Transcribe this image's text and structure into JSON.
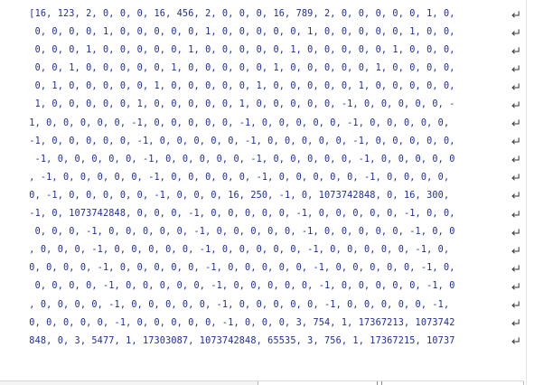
{
  "editor": {
    "lines": [
      " [16, 123, 2, 0, 0, 0, 16, 456, 2, 0, 0, 0, 16, 789, 2, 0, 0, 0, 0, 0, 1, 0,",
      "  0, 0, 0, 0, 1, 0, 0, 0, 0, 0, 1, 0, 0, 0, 0, 0, 1, 0, 0, 0, 0, 0, 1, 0, 0,",
      "  0, 0, 0, 1, 0, 0, 0, 0, 0, 1, 0, 0, 0, 0, 0, 1, 0, 0, 0, 0, 0, 1, 0, 0, 0,",
      "  0, 0, 1, 0, 0, 0, 0, 0, 1, 0, 0, 0, 0, 0, 1, 0, 0, 0, 0, 0, 1, 0, 0, 0, 0,",
      "  0, 1, 0, 0, 0, 0, 0, 1, 0, 0, 0, 0, 0, 1, 0, 0, 0, 0, 0, 1, 0, 0, 0, 0, 0,",
      "  1, 0, 0, 0, 0, 0, 1, 0, 0, 0, 0, 0, 1, 0, 0, 0, 0, 0, -1, 0, 0, 0, 0, 0, -",
      " 1, 0, 0, 0, 0, 0, -1, 0, 0, 0, 0, 0, -1, 0, 0, 0, 0, 0, -1, 0, 0, 0, 0, 0,",
      " -1, 0, 0, 0, 0, 0, -1, 0, 0, 0, 0, 0, -1, 0, 0, 0, 0, 0, -1, 0, 0, 0, 0, 0,",
      "  -1, 0, 0, 0, 0, 0, -1, 0, 0, 0, 0, 0, -1, 0, 0, 0, 0, 0, -1, 0, 0, 0, 0, 0",
      " , -1, 0, 0, 0, 0, 0, -1, 0, 0, 0, 0, 0, -1, 0, 0, 0, 0, 0, -1, 0, 0, 0, 0,",
      " 0, -1, 0, 0, 0, 0, 0, -1, 0, 0, 0, 16, 250, -1, 0, 1073742848, 0, 16, 300,",
      " -1, 0, 1073742848, 0, 0, 0, -1, 0, 0, 0, 0, 0, -1, 0, 0, 0, 0, 0, -1, 0, 0,",
      "  0, 0, 0, -1, 0, 0, 0, 0, 0, -1, 0, 0, 0, 0, 0, -1, 0, 0, 0, 0, 0, -1, 0, 0",
      " , 0, 0, 0, -1, 0, 0, 0, 0, 0, -1, 0, 0, 0, 0, 0, -1, 0, 0, 0, 0, 0, -1, 0,",
      " 0, 0, 0, 0, -1, 0, 0, 0, 0, 0, -1, 0, 0, 0, 0, 0, -1, 0, 0, 0, 0, 0, -1, 0,",
      "  0, 0, 0, 0, -1, 0, 0, 0, 0, 0, -1, 0, 0, 0, 0, 0, -1, 0, 0, 0, 0, 0, -1, 0",
      " , 0, 0, 0, 0, -1, 0, 0, 0, 0, 0, -1, 0, 0, 0, 0, 0, -1, 0, 0, 0, 0, 0, -1,",
      " 0, 0, 0, 0, 0, -1, 0, 0, 0, 0, 0, -1, 0, 0, 0, 3, 754, 1, 17367213, 1073742",
      " 848, 0, 3, 5477, 1, 17303087, 1073742848, 65535, 3, 756, 1, 17367215, 10737"
    ],
    "line_end_icon": "crlf-return-icon",
    "text_color": "#1f2d9c",
    "icon_color": "#333333"
  }
}
